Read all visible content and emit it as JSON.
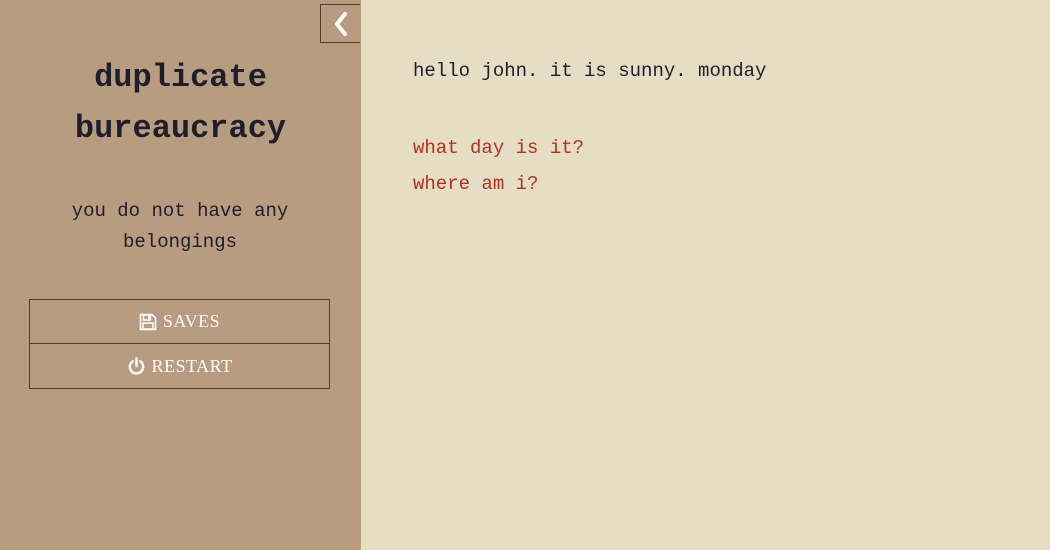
{
  "sidebar": {
    "title": "duplicate bureaucracy",
    "inventory_text": "you do not have any belongings",
    "saves_label": "SAVES",
    "restart_label": "RESTART",
    "collapse_icon": "chevron-left-icon",
    "saves_icon": "floppy-disk-icon",
    "restart_icon": "power-icon"
  },
  "main": {
    "narration": "hello john. it is sunny. monday",
    "choices": [
      {
        "label": "what day is it?"
      },
      {
        "label": "where am i?"
      }
    ]
  },
  "colors": {
    "sidebar_bg": "#b89c7f",
    "main_bg": "#e6ddc5",
    "text": "#1e1f2c",
    "choice_link": "#b8311e",
    "button_text": "#ffffff"
  }
}
